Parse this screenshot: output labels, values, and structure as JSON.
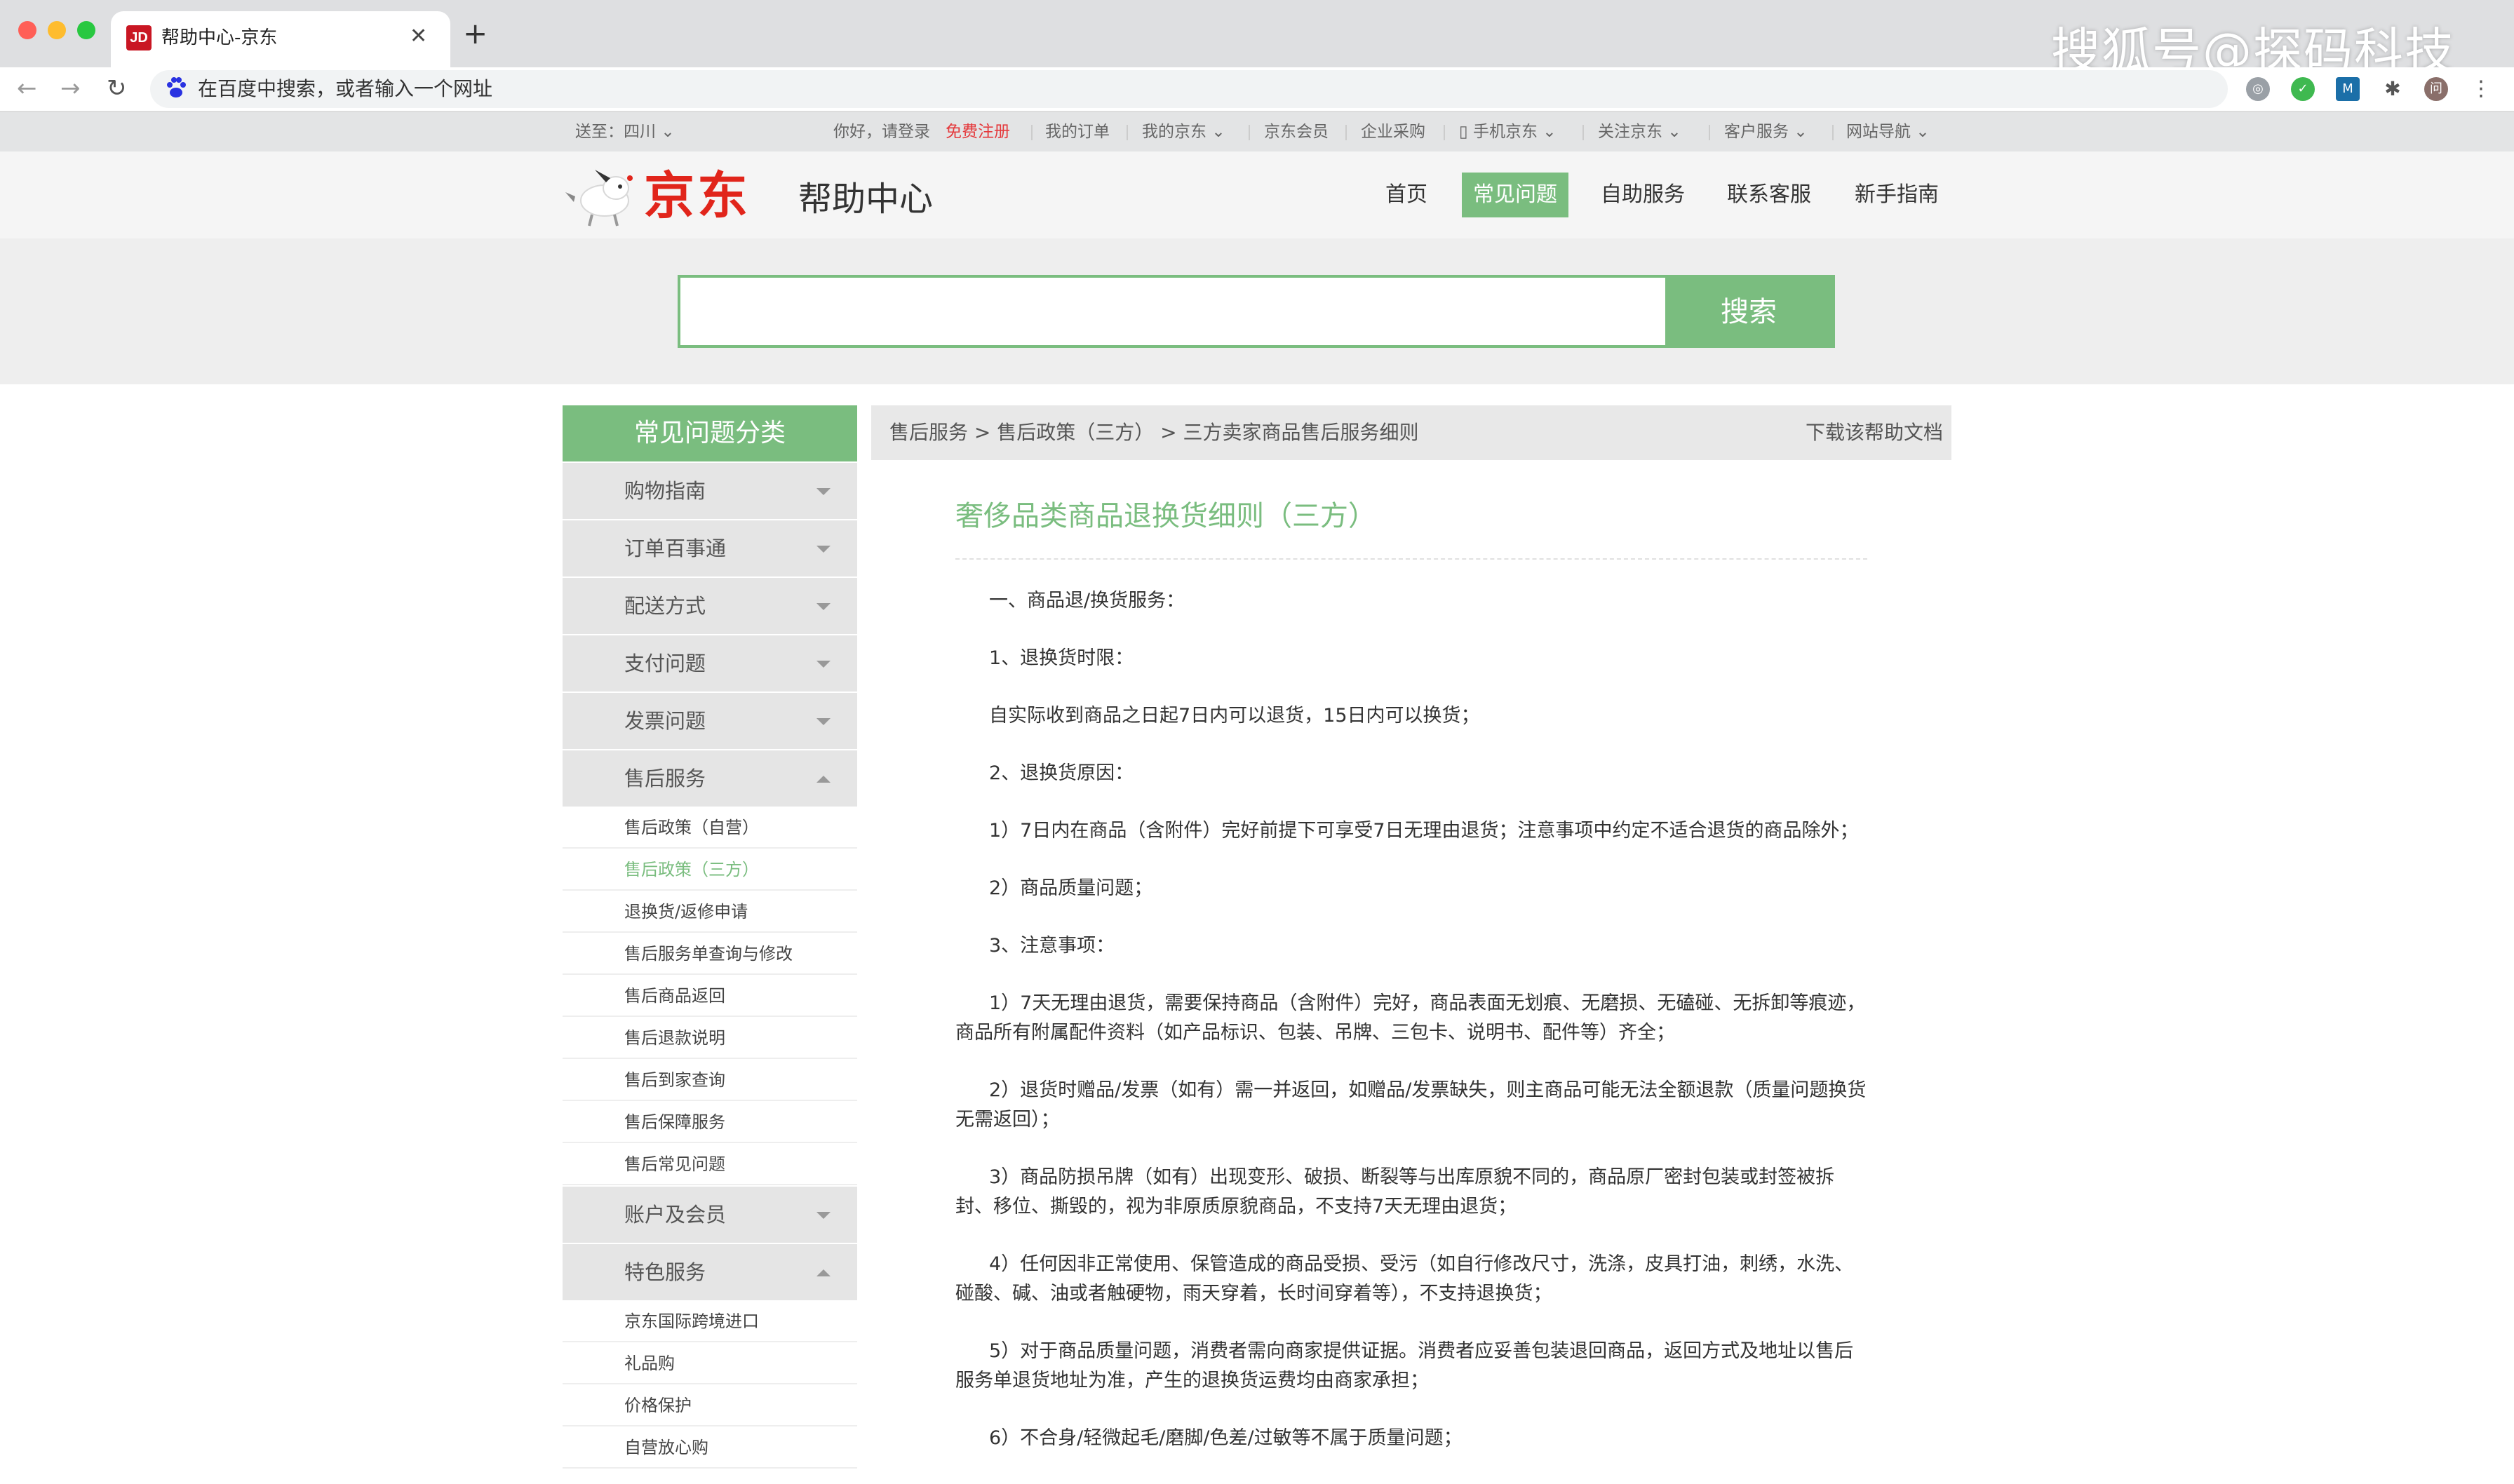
{
  "browser": {
    "tab_title": "帮助中心-京东",
    "tab_favicon": "JD",
    "omnibox_placeholder": "在百度中搜索，或者输入一个网址",
    "watermark": "搜狐号@探码科技",
    "avatar_text": "问",
    "traffic_lights": [
      "#ff5f57",
      "#febc2e",
      "#28c840"
    ]
  },
  "topbar": {
    "location": "送至：四川",
    "greeting": "你好，请登录",
    "register": "免费注册",
    "links": [
      "我的订单",
      "我的京东",
      "京东会员",
      "企业采购",
      "手机京东",
      "关注京东",
      "客户服务",
      "网站导航"
    ]
  },
  "header": {
    "logo": "京东",
    "subtitle": "帮助中心",
    "nav": [
      "首页",
      "常见问题",
      "自助服务",
      "联系客服",
      "新手指南"
    ],
    "active_nav": "常见问题"
  },
  "search": {
    "value": "",
    "button": "搜索"
  },
  "sidebar": {
    "title": "常见问题分类",
    "collapsed_top": [
      "购物指南",
      "订单百事通",
      "配送方式",
      "支付问题",
      "发票问题"
    ],
    "after_sales": {
      "label": "售后服务",
      "items": [
        "售后政策（自营）",
        "售后政策（三方）",
        "退换货/返修申请",
        "售后服务单查询与修改",
        "售后商品返回",
        "售后退款说明",
        "售后到家查询",
        "售后保障服务",
        "售后常见问题"
      ],
      "active_item": "售后政策（三方）"
    },
    "account": "账户及会员",
    "special": {
      "label": "特色服务",
      "items": [
        "京东国际跨境进口",
        "礼品购",
        "价格保护",
        "自营放心购"
      ]
    }
  },
  "content": {
    "breadcrumb": "售后服务 > 售后政策（三方） > 三方卖家商品售后服务细则",
    "download": "下载该帮助文档",
    "title": "奢侈品类商品退换货细则（三方）",
    "paragraphs": [
      "一、商品退/换货服务：",
      "1、退换货时限：",
      "自实际收到商品之日起7日内可以退货，15日内可以换货；",
      "2、退换货原因：",
      "1）7日内在商品（含附件）完好前提下可享受7日无理由退货；注意事项中约定不适合退货的商品除外；",
      "2）商品质量问题；",
      "3、注意事项：",
      "1）7天无理由退货，需要保持商品（含附件）完好，商品表面无划痕、无磨损、无磕碰、无拆卸等痕迹，商品所有附属配件资料（如产品标识、包装、吊牌、三包卡、说明书、配件等）齐全；",
      "2）退货时赠品/发票（如有）需一并返回，如赠品/发票缺失，则主商品可能无法全额退款（质量问题换货无需返回）；",
      "3）商品防损吊牌（如有）出现变形、破损、断裂等与出库原貌不同的，商品原厂密封包装或封签被拆封、移位、撕毁的，视为非原质原貌商品，不支持7天无理由退货；",
      "4）任何因非正常使用、保管造成的商品受损、受污（如自行修改尺寸，洗涤，皮具打油，刺绣，水洗、碰酸、碱、油或者触硬物，雨天穿着，长时间穿着等），不支持退换货；",
      "5）对于商品质量问题，消费者需向商家提供证据。消费者应妥善包装退回商品，返回方式及地址以售后服务单退货地址为准，产生的退换货运费均由商家承担；",
      "6）不合身/轻微起毛/磨脚/色差/过敏等不属于质量问题；"
    ]
  },
  "colors": {
    "accent_green": "#7abd7f",
    "jd_red": "#e1251b",
    "link_red": "#e4393c"
  }
}
